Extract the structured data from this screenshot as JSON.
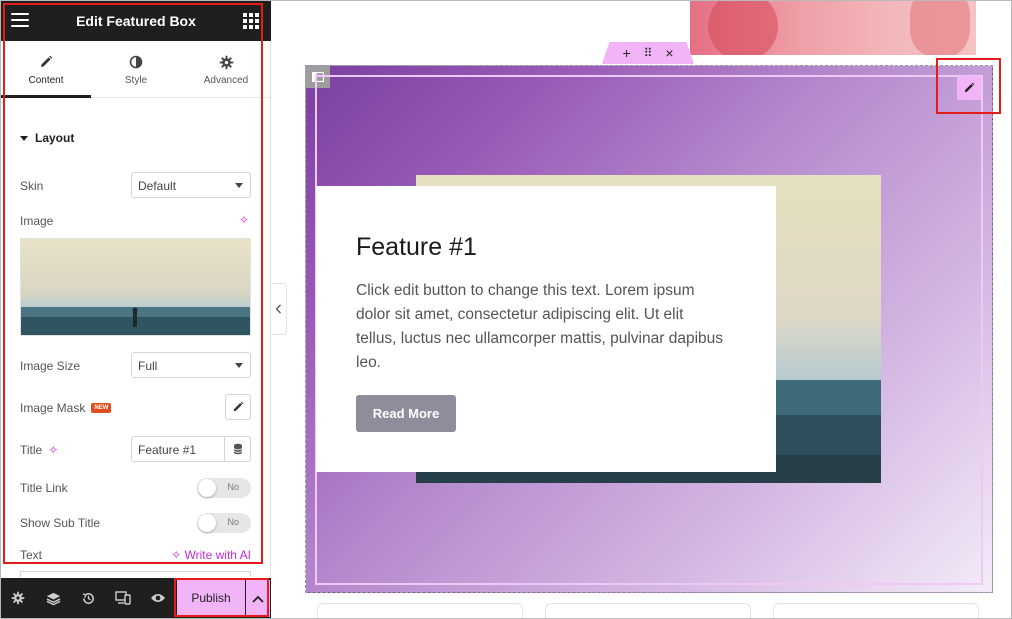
{
  "panel": {
    "title": "Edit Featured Box",
    "tabs": [
      {
        "label": "Content",
        "icon": "pencil-icon"
      },
      {
        "label": "Style",
        "icon": "contrast-icon"
      },
      {
        "label": "Advanced",
        "icon": "gear-icon"
      }
    ],
    "section_title": "Layout",
    "controls": {
      "skin_label": "Skin",
      "skin_value": "Default",
      "image_label": "Image",
      "image_size_label": "Image Size",
      "image_size_value": "Full",
      "image_mask_label": "Image Mask",
      "new_badge": "NEW",
      "title_label": "Title",
      "title_value": "Feature #1",
      "title_link_label": "Title Link",
      "title_link_toggle": "No",
      "show_sub_title_label": "Show Sub Title",
      "show_sub_title_toggle": "No",
      "text_label": "Text",
      "write_ai_label": "Write with AI"
    },
    "footer": {
      "publish_label": "Publish"
    }
  },
  "canvas": {
    "feature": {
      "title": "Feature #1",
      "text": "Click edit button to change this text. Lorem ipsum dolor sit amet, consectetur adipiscing elit. Ut elit tellus, luctus nec ullamcorper mattis, pulvinar dapibus leo.",
      "button_label": "Read More"
    },
    "section_handle": {
      "add": "+",
      "move": "⠿",
      "close": "×"
    }
  },
  "colors": {
    "accent": "#f2b4f8",
    "highlight_border": "#e31c1c",
    "panel_header_bg": "#1f1f1f",
    "ai_accent": "#c12fd2",
    "new_badge_bg": "#e14e1b",
    "read_more_bg": "#8d8d9b"
  }
}
